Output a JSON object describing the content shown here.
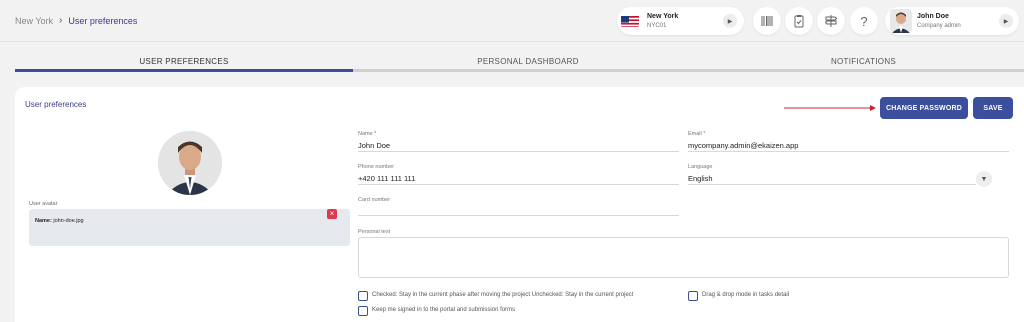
{
  "breadcrumb": {
    "root": "New York",
    "separator": "›",
    "current": "User preferences"
  },
  "location": {
    "name": "New York",
    "code": "NYC01"
  },
  "header_icons": [
    "barcode-icon",
    "clipboard-check-icon",
    "signpost-icon",
    "help-icon"
  ],
  "help_glyph": "?",
  "user": {
    "name": "John Doe",
    "role": "Company admin"
  },
  "tabs": [
    {
      "label": "USER PREFERENCES",
      "active": true
    },
    {
      "label": "PERSONAL DASHBOARD",
      "active": false
    },
    {
      "label": "NOTIFICATIONS",
      "active": false
    }
  ],
  "panel": {
    "title": "User preferences",
    "change_password_label": "CHANGE PASSWORD",
    "save_label": "SAVE"
  },
  "avatar_section": {
    "label": "User avatar",
    "file_name_label": "Name:",
    "file_name": "john-doe.jpg",
    "remove_glyph": "×"
  },
  "form": {
    "name": {
      "label": "Name *",
      "value": "John Doe"
    },
    "email": {
      "label": "Email *",
      "value": "mycompany.admin@ekaizen.app"
    },
    "phone": {
      "label": "Phone number",
      "value": "+420 111 111 111"
    },
    "language": {
      "label": "Language",
      "value": "English"
    },
    "card": {
      "label": "Card number",
      "value": ""
    },
    "personal_text": {
      "label": "Personal text",
      "value": ""
    }
  },
  "checkboxes": [
    {
      "label": "Checked: Stay in the current phase after moving the project Unchecked: Stay in the current project",
      "checked": false
    },
    {
      "label": "Drag & drop mode in tasks detail",
      "checked": false
    },
    {
      "label": "Keep me signed in to the portal and submission forms",
      "checked": false
    }
  ],
  "colors": {
    "accent": "#3c4f9c",
    "breadcrumb": "#3b3b8c",
    "danger": "#e03a4a",
    "arrow": "#d0202a"
  }
}
